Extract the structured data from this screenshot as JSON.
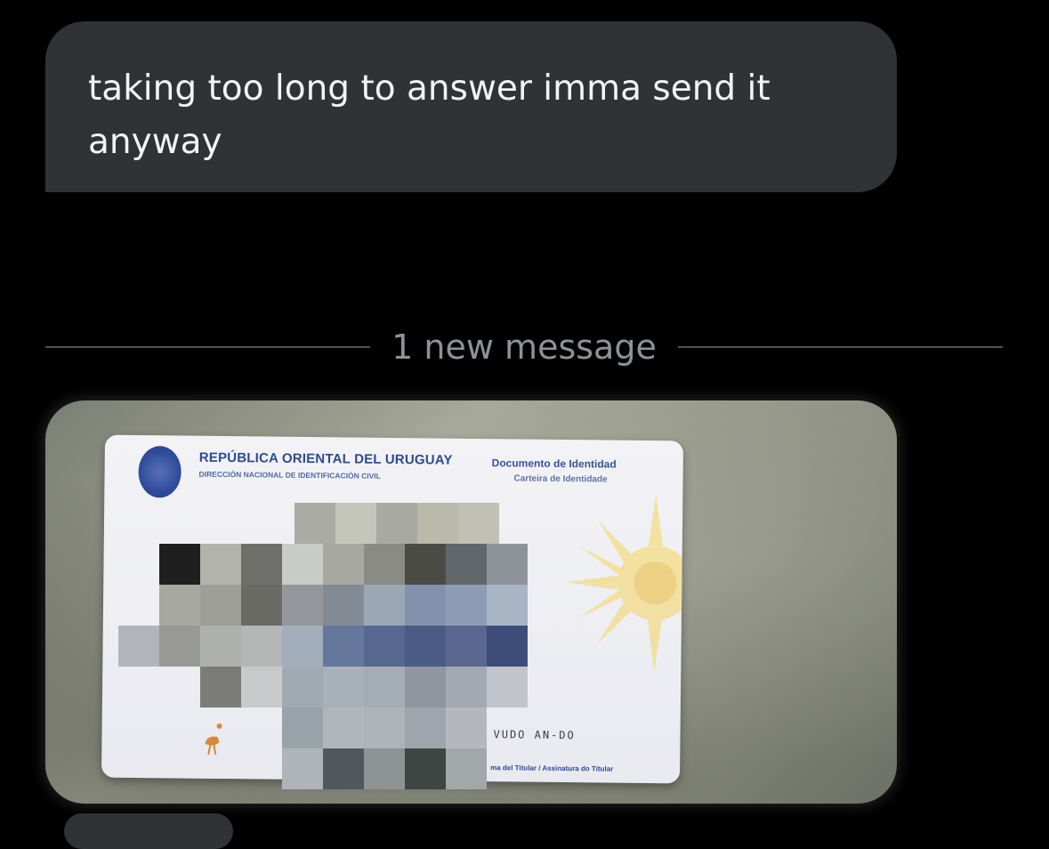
{
  "messages": {
    "text_message": "taking too long to answer imma send it anyway",
    "divider_label": "1 new message"
  },
  "id_card": {
    "title": "REPÚBLICA ORIENTAL DEL URUGUAY",
    "subtitle": "DIRECCIÓN NACIONAL DE IDENTIFICACIÓN CIVIL",
    "document_label": "Documento de Identidad",
    "document_label_pt": "Carteira de Identidade",
    "signature_text": "VUDO AN-DO",
    "signature_caption": "ma del Titular / Assinatura do Titular"
  },
  "colors": {
    "background": "#000000",
    "bubble": "#2f3336",
    "divider_text": "#8b939a"
  }
}
